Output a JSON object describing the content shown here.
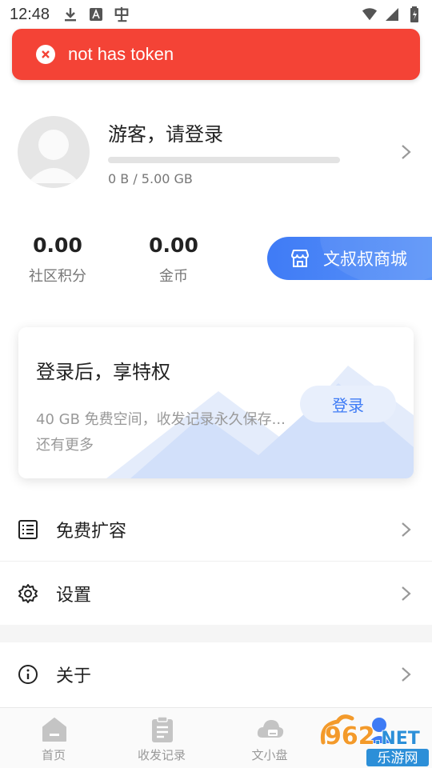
{
  "status_bar": {
    "time": "12:48"
  },
  "toast": {
    "message": "not has token"
  },
  "profile": {
    "name": "游客，请登录",
    "storage_text": "0 B / 5.00 GB",
    "storage_progress": 0
  },
  "stats": [
    {
      "value": "0.00",
      "label": "社区积分"
    },
    {
      "value": "0.00",
      "label": "金币"
    }
  ],
  "shop_button": {
    "label": "文叔叔商城"
  },
  "promo": {
    "title": "登录后，享特权",
    "description": "40 GB 免费空间，收发记录永久保存... 还有更多",
    "login_label": "登录"
  },
  "menu": [
    {
      "label": "免费扩容",
      "icon": "list-icon"
    },
    {
      "label": "设置",
      "icon": "gear-icon"
    },
    {
      "label": "关于",
      "icon": "info-icon"
    }
  ],
  "tabbar": [
    {
      "label": "首页",
      "icon": "home-icon"
    },
    {
      "label": "收发记录",
      "icon": "clipboard-icon"
    },
    {
      "label": "文小盘",
      "icon": "cloud-drive-icon"
    },
    {
      "label": "",
      "icon": "user-icon"
    }
  ],
  "watermark": {
    "text_number": "962",
    "text_domain": ".NET",
    "text_cn": "乐游网"
  },
  "colors": {
    "accent": "#3e7bf5",
    "toast": "#f44336",
    "text_secondary": "#999999"
  }
}
